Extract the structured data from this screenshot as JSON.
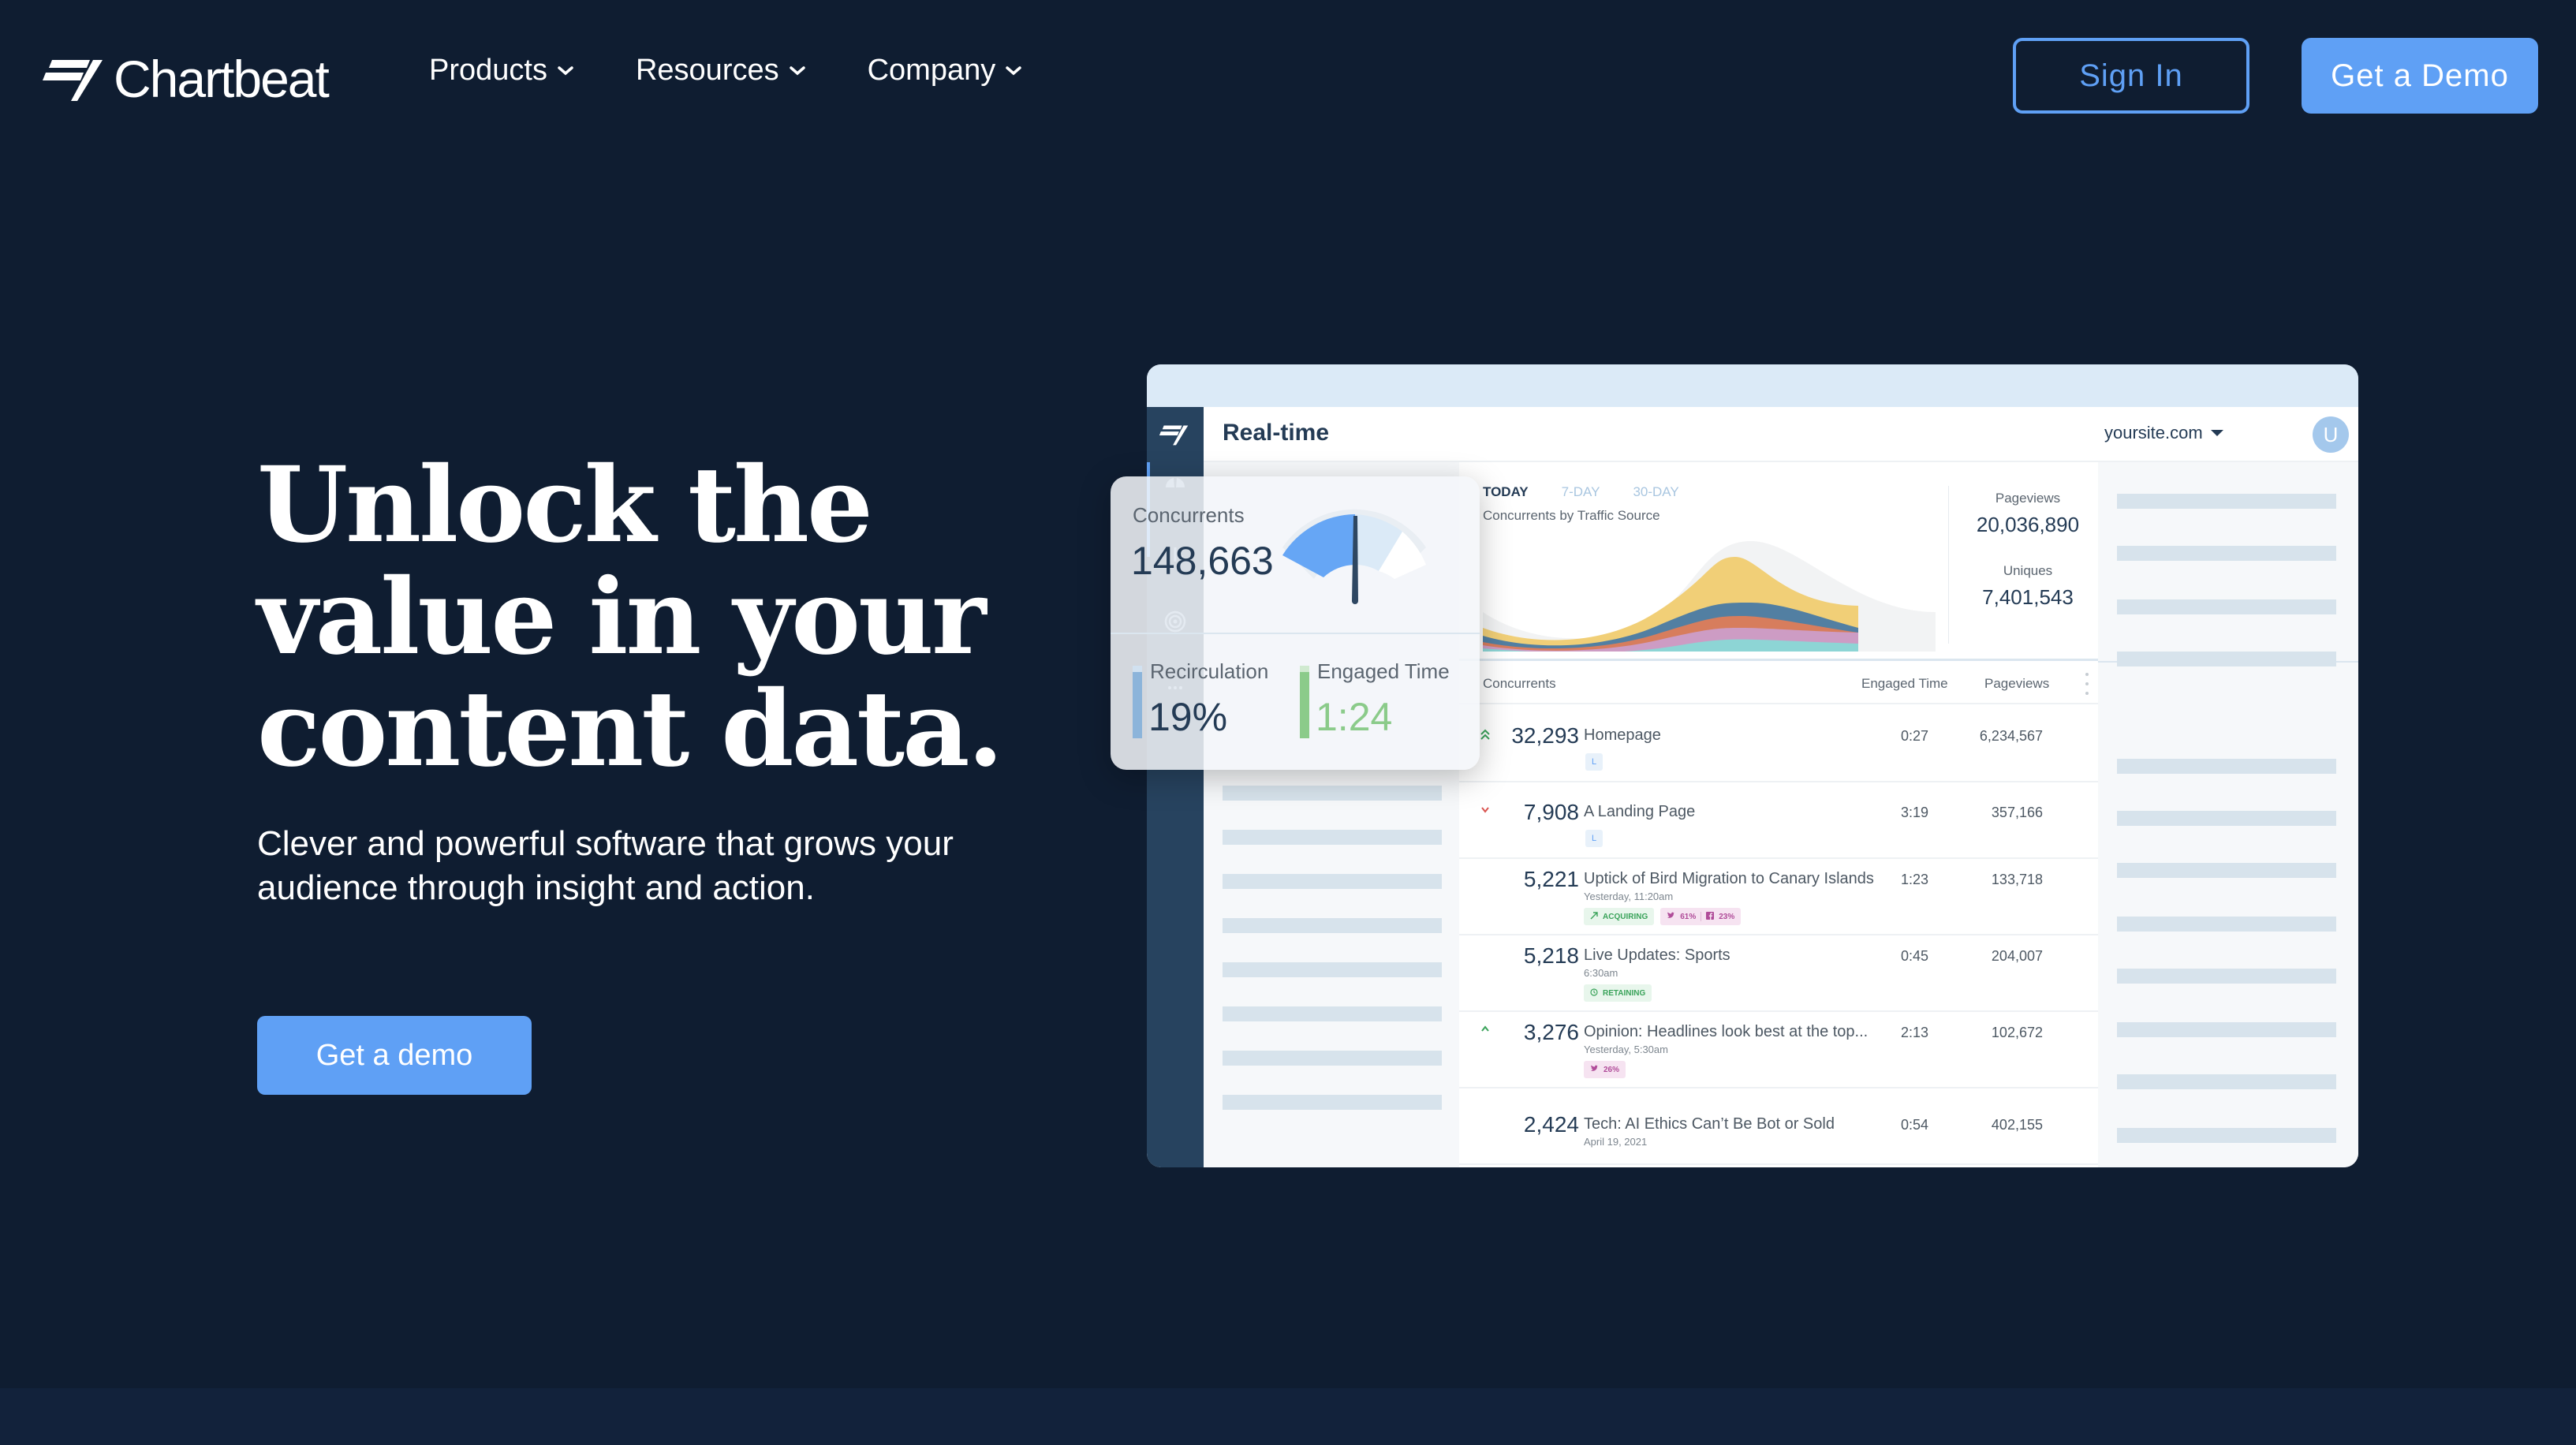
{
  "nav": {
    "logo_text": "Chartbeat",
    "menu": [
      {
        "label": "Products"
      },
      {
        "label": "Resources"
      },
      {
        "label": "Company"
      }
    ],
    "sign_in": "Sign In",
    "get_demo": "Get a Demo"
  },
  "hero": {
    "title_lines": [
      "Unlock the",
      "value in your",
      "content data."
    ],
    "subtitle": "Clever and powerful software that grows your audience through insight and action.",
    "cta": "Get a demo"
  },
  "dashboard": {
    "title": "Real-time",
    "site": "yoursite.com",
    "avatar_initial": "U",
    "range_tabs": [
      {
        "label": "TODAY",
        "active": true
      },
      {
        "label": "7-DAY",
        "active": false
      },
      {
        "label": "30-DAY",
        "active": false
      }
    ],
    "chart_label": "Concurrents by Traffic Source",
    "stats": [
      {
        "label": "Pageviews",
        "value": "20,036,890"
      },
      {
        "label": "Uniques",
        "value": "7,401,543"
      }
    ],
    "table": {
      "headers": {
        "concurrents": "Concurrents",
        "engaged": "Engaged Time",
        "pageviews": "Pageviews"
      },
      "rows": [
        {
          "trend": "up-strong",
          "concurrents": "32,293",
          "title": "Homepage",
          "sub": "",
          "engaged": "0:27",
          "pageviews": "6,234,567",
          "tag_l": "L",
          "tags": []
        },
        {
          "trend": "down",
          "concurrents": "7,908",
          "title": "A Landing Page",
          "sub": "",
          "engaged": "3:19",
          "pageviews": "357,166",
          "tag_l": "L",
          "tags": []
        },
        {
          "trend": "",
          "concurrents": "5,221",
          "title": "Uptick of Bird Migration to Canary Islands",
          "sub": "Yesterday, 11:20am",
          "engaged": "1:23",
          "pageviews": "133,718",
          "tag_l": "",
          "tags": [
            {
              "type": "green",
              "icon": "trend-up-icon",
              "text": "ACQUIRING"
            },
            {
              "type": "pink",
              "icon": "twitter-icon",
              "text": "61%",
              "icon2": "facebook-icon",
              "text2": "23%"
            }
          ]
        },
        {
          "trend": "",
          "concurrents": "5,218",
          "title": "Live Updates: Sports",
          "sub": "6:30am",
          "engaged": "0:45",
          "pageviews": "204,007",
          "tag_l": "",
          "tags": [
            {
              "type": "green",
              "icon": "clock-icon",
              "text": "RETAINING"
            }
          ]
        },
        {
          "trend": "up",
          "concurrents": "3,276",
          "title": "Opinion: Headlines look best at the top...",
          "sub": "Yesterday, 5:30am",
          "engaged": "2:13",
          "pageviews": "102,672",
          "tag_l": "",
          "tags": [
            {
              "type": "pink",
              "icon": "twitter-icon",
              "text": "26%"
            }
          ]
        },
        {
          "trend": "",
          "concurrents": "2,424",
          "title": "Tech: AI Ethics Can’t Be Bot or Sold",
          "sub": "April 19, 2021",
          "engaged": "0:54",
          "pageviews": "402,155",
          "tag_l": "",
          "tags": []
        }
      ]
    },
    "overlay": {
      "concurrents_label": "Concurrents",
      "concurrents_value": "148,663",
      "gauge_fill_fraction": 0.5,
      "recirculation_label": "Recirculation",
      "recirculation_value": "19%",
      "engaged_label": "Engaged Time",
      "engaged_value": "1:24"
    }
  },
  "colors": {
    "background": "#0f1d31",
    "accent": "#5fa0f5",
    "dash_navy": "#243b55",
    "sidebar": "#27435f",
    "green": "#8bcb8a",
    "stream": [
      "#f1cf77",
      "#527fa2",
      "#d77d5d",
      "#cd9cc4",
      "#8dd5d5"
    ]
  }
}
